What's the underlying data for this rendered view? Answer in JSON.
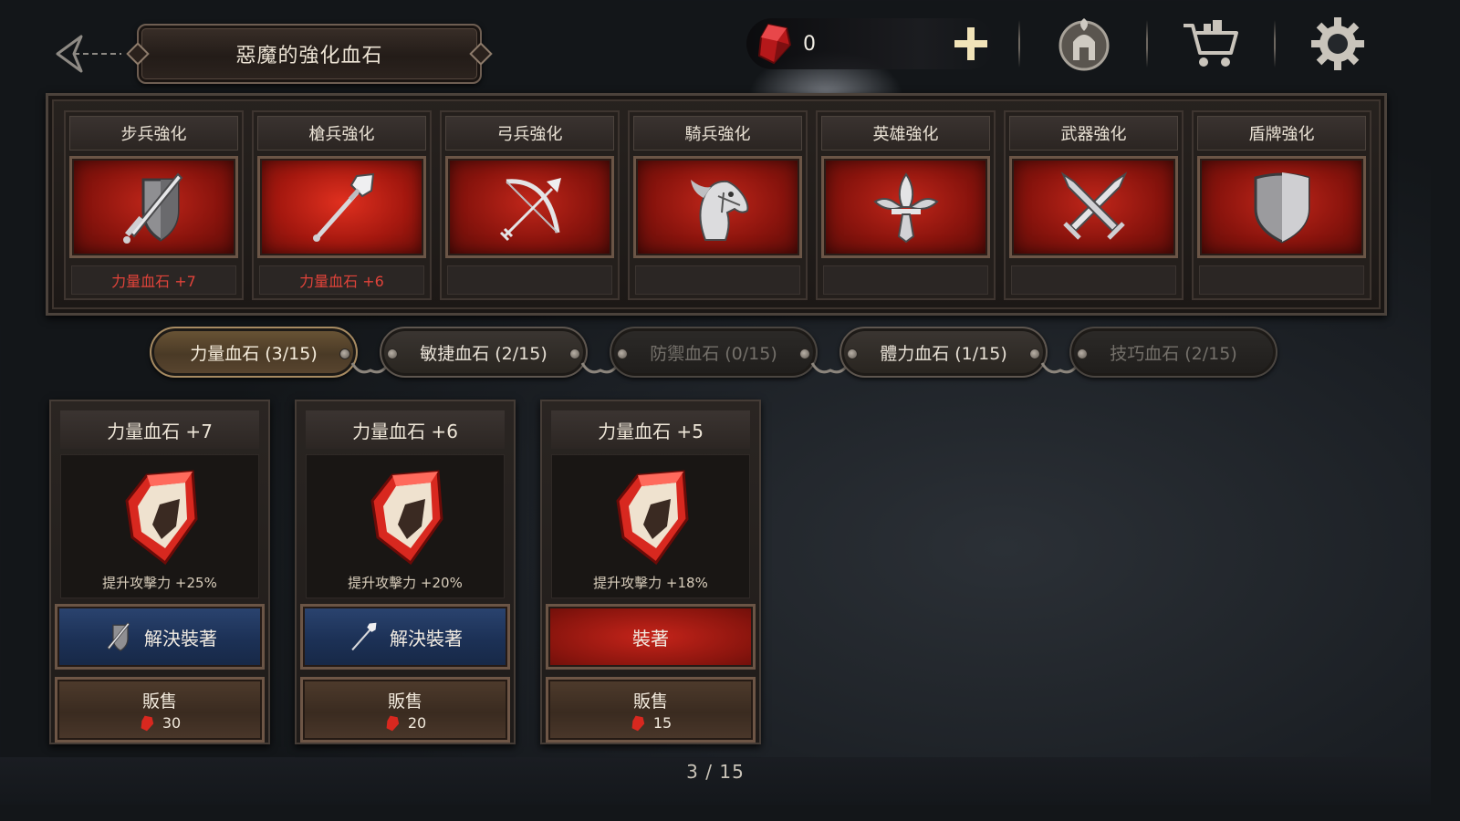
{
  "header": {
    "title": "惡魔的強化血石",
    "currency_amount": "0"
  },
  "slots": [
    {
      "label": "步兵強化",
      "gem": "力量血石 +7",
      "icon": "sword-shield-icon"
    },
    {
      "label": "槍兵強化",
      "gem": "力量血石 +6",
      "icon": "spear-icon"
    },
    {
      "label": "弓兵強化",
      "gem": "",
      "icon": "bow-arrow-icon"
    },
    {
      "label": "騎兵強化",
      "gem": "",
      "icon": "horse-head-icon"
    },
    {
      "label": "英雄強化",
      "gem": "",
      "icon": "fleur-de-lis-icon"
    },
    {
      "label": "武器強化",
      "gem": "",
      "icon": "crossed-swords-icon"
    },
    {
      "label": "盾牌強化",
      "gem": "",
      "icon": "shield-icon"
    }
  ],
  "tabs": [
    {
      "label": "力量血石 (3/15)",
      "state": "active"
    },
    {
      "label": "敏捷血石 (2/15)",
      "state": "normal"
    },
    {
      "label": "防禦血石 (0/15)",
      "state": "disabled"
    },
    {
      "label": "體力血石 (1/15)",
      "state": "normal"
    },
    {
      "label": "技巧血石 (2/15)",
      "state": "disabled"
    }
  ],
  "cards": [
    {
      "title": "力量血石 +7",
      "effect": "提升攻擊力 +25%",
      "action": "解決裝著",
      "action_style": "blue",
      "action_icon": "sword-shield-icon",
      "sell_label": "販售",
      "price": "30"
    },
    {
      "title": "力量血石 +6",
      "effect": "提升攻擊力 +20%",
      "action": "解決裝著",
      "action_style": "blue",
      "action_icon": "spear-icon",
      "sell_label": "販售",
      "price": "20"
    },
    {
      "title": "力量血石 +5",
      "effect": "提升攻擊力 +18%",
      "action": "裝著",
      "action_style": "red",
      "action_icon": "",
      "sell_label": "販售",
      "price": "15"
    }
  ],
  "pager": "3 / 15",
  "colors": {
    "gem_red": "#d8281f",
    "active_tab": "#6b5536",
    "unequip_blue": "#1c3156",
    "equip_red": "#8b150e"
  }
}
